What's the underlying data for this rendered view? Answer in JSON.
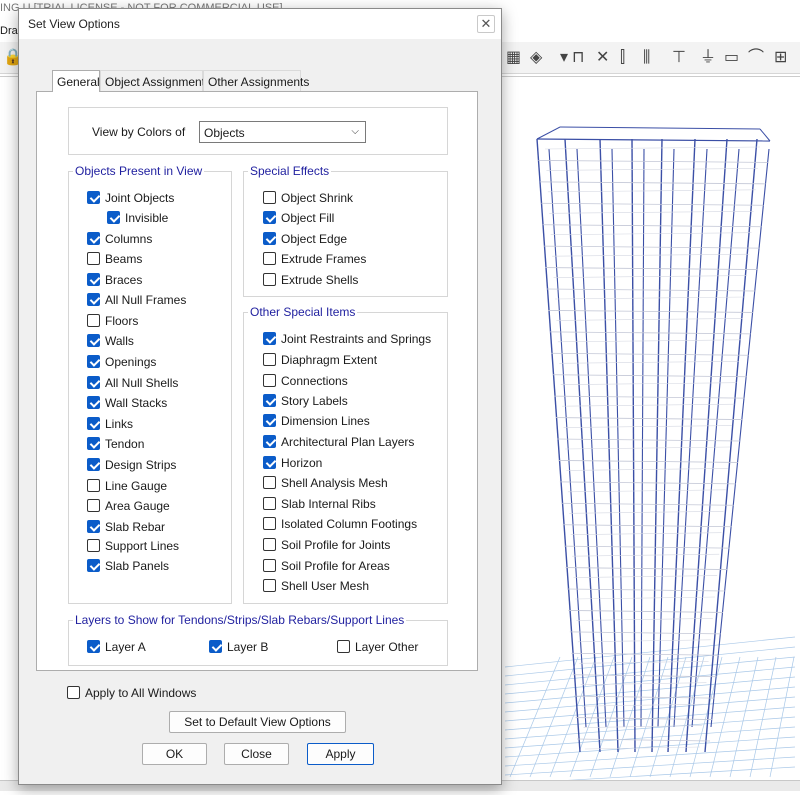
{
  "app": {
    "title_text": "ING U  [TRIAL LICENSE - NOT FOR COMMERCIAL USE]",
    "menu_text": "Dra"
  },
  "dialog": {
    "title": "Set View Options",
    "close_glyph": "✕",
    "tabs": [
      {
        "label": "General"
      },
      {
        "label": "Object Assignments"
      },
      {
        "label": "Other Assignments"
      }
    ],
    "view_by": {
      "label": "View by Colors of",
      "value": "Objects"
    },
    "objects_group": {
      "title": "Objects Present in View",
      "items": [
        {
          "label": "Joint Objects",
          "checked": true
        },
        {
          "label": "Invisible",
          "checked": true
        },
        {
          "label": "Columns",
          "checked": true
        },
        {
          "label": "Beams",
          "checked": false
        },
        {
          "label": "Braces",
          "checked": true
        },
        {
          "label": "All Null Frames",
          "checked": true
        },
        {
          "label": "Floors",
          "checked": false
        },
        {
          "label": "Walls",
          "checked": true
        },
        {
          "label": "Openings",
          "checked": true
        },
        {
          "label": "All Null Shells",
          "checked": true
        },
        {
          "label": "Wall Stacks",
          "checked": true
        },
        {
          "label": "Links",
          "checked": true
        },
        {
          "label": "Tendon",
          "checked": true
        },
        {
          "label": "Design Strips",
          "checked": true
        },
        {
          "label": "Line Gauge",
          "checked": false
        },
        {
          "label": "Area Gauge",
          "checked": false
        },
        {
          "label": "Slab Rebar",
          "checked": true
        },
        {
          "label": "Support Lines",
          "checked": false
        },
        {
          "label": "Slab Panels",
          "checked": true
        }
      ]
    },
    "special_effects": {
      "title": "Special Effects",
      "items": [
        {
          "label": "Object Shrink",
          "checked": false
        },
        {
          "label": "Object Fill",
          "checked": true
        },
        {
          "label": "Object Edge",
          "checked": true
        },
        {
          "label": "Extrude Frames",
          "checked": false
        },
        {
          "label": "Extrude Shells",
          "checked": false
        }
      ]
    },
    "other_special": {
      "title": "Other Special Items",
      "items": [
        {
          "label": "Joint Restraints and Springs",
          "checked": true
        },
        {
          "label": "Diaphragm Extent",
          "checked": false
        },
        {
          "label": "Connections",
          "checked": false
        },
        {
          "label": "Story Labels",
          "checked": true
        },
        {
          "label": "Dimension Lines",
          "checked": true
        },
        {
          "label": "Architectural Plan Layers",
          "checked": true
        },
        {
          "label": "Horizon",
          "checked": true
        },
        {
          "label": "Shell Analysis Mesh",
          "checked": false
        },
        {
          "label": "Slab Internal Ribs",
          "checked": false
        },
        {
          "label": "Isolated Column Footings",
          "checked": false
        },
        {
          "label": "Soil Profile for Joints",
          "checked": false
        },
        {
          "label": "Soil Profile for Areas",
          "checked": false
        },
        {
          "label": "Shell User Mesh",
          "checked": false
        }
      ]
    },
    "layers_group": {
      "title": "Layers to Show for Tendons/Strips/Slab Rebars/Support Lines",
      "items": [
        {
          "label": "Layer A",
          "checked": true
        },
        {
          "label": "Layer B",
          "checked": true
        },
        {
          "label": "Layer Other",
          "checked": false
        }
      ]
    },
    "apply_all": {
      "label": "Apply to All Windows",
      "checked": false
    },
    "buttons": {
      "default_view": "Set to Default View Options",
      "ok": "OK",
      "close": "Close",
      "apply": "Apply"
    }
  },
  "colors": {
    "accent": "#0b5cc9",
    "group_title": "#1f1f9f",
    "model_lines": "#3b4fa6"
  }
}
